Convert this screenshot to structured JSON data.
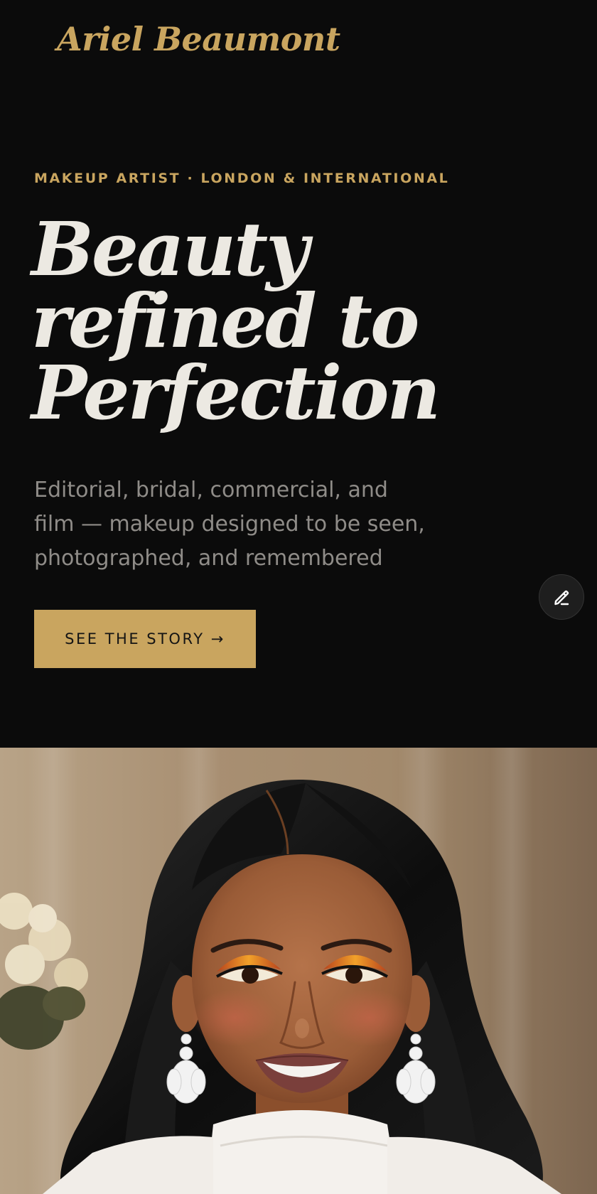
{
  "brand": {
    "name": "Ariel Beaumont"
  },
  "hero": {
    "eyebrow": "MAKEUP ARTIST · LONDON & INTERNATIONAL",
    "headline_lines": [
      "Beauty",
      "refined to",
      "Perfection"
    ],
    "subcopy_lines": [
      "Editorial, bridal, commercial, and",
      "film — makeup designed to be seen,",
      "photographed, and remembered"
    ],
    "cta_label": "SEE THE STORY →"
  },
  "floating_action": {
    "icon": "pencil-edit-icon"
  },
  "portrait": {
    "icon": "portrait-photo"
  },
  "colors": {
    "background": "#0b0b0b",
    "accent_gold": "#c9a55f",
    "headline": "#ece9e2",
    "body_text": "#8f8c88",
    "fab_bg": "#1e1e1e"
  }
}
